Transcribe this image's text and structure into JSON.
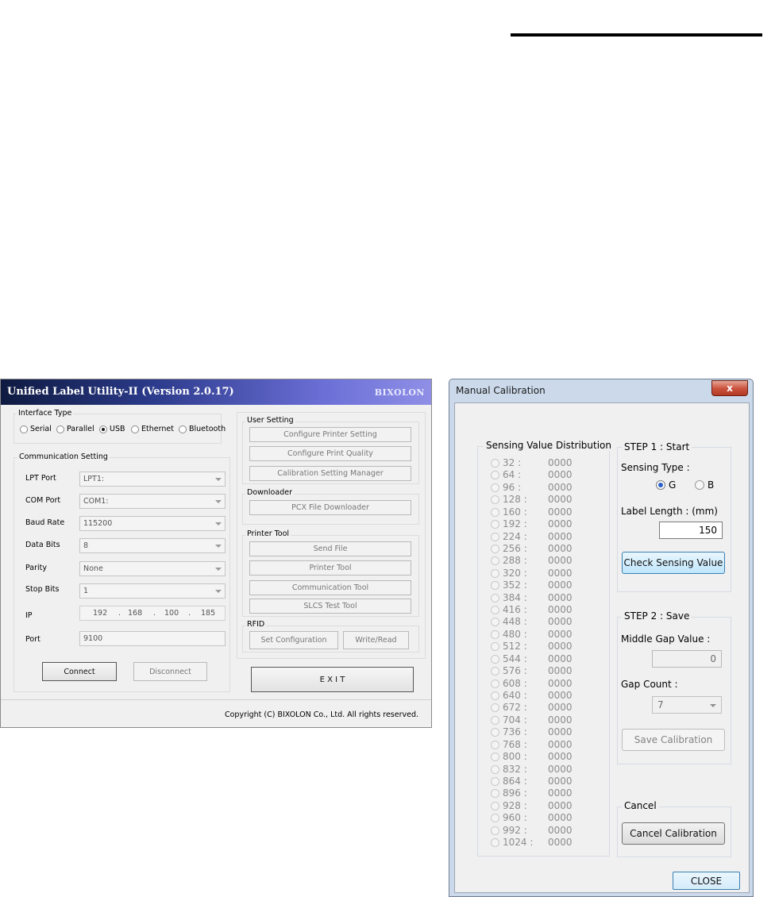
{
  "ulu": {
    "title": "Unified Label Utility-II (Version 2.0.17)",
    "brand": "BIXOLON",
    "interface_type": {
      "label": "Interface Type",
      "options": [
        "Serial",
        "Parallel",
        "USB",
        "Ethernet",
        "Bluetooth"
      ],
      "selected": "USB"
    },
    "comm": {
      "label": "Communication Setting",
      "lpt_label": "LPT Port",
      "lpt_value": "LPT1:",
      "com_label": "COM Port",
      "com_value": "COM1:",
      "baud_label": "Baud Rate",
      "baud_value": "115200",
      "databits_label": "Data Bits",
      "databits_value": "8",
      "parity_label": "Parity",
      "parity_value": "None",
      "stopbits_label": "Stop Bits",
      "stopbits_value": "1",
      "ip_label": "IP",
      "ip": [
        "192",
        "168",
        "100",
        "185"
      ],
      "ip_sep": ".",
      "port_label": "Port",
      "port_value": "9100",
      "connect": "Connect",
      "disconnect": "Disconnect"
    },
    "user_setting": {
      "label": "User Setting",
      "configure_printer": "Configure Printer Setting",
      "configure_quality": "Configure Print Quality",
      "calibration_manager": "Calibration Setting Manager"
    },
    "downloader": {
      "label": "Downloader",
      "pcx": "PCX File Downloader"
    },
    "printer_tool": {
      "label": "Printer Tool",
      "send_file": "Send File",
      "printer_tool": "Printer Tool",
      "communication_tool": "Communication Tool",
      "slcs_tool": "SLCS Test Tool"
    },
    "rfid": {
      "label": "RFID",
      "set_config": "Set Configuration",
      "write_read": "Write/Read"
    },
    "exit": "E X I T",
    "copyright": "Copyright (C) BIXOLON Co., Ltd. All rights reserved."
  },
  "calib": {
    "title": "Manual Calibration",
    "close_x": "x",
    "dist_label": "Sensing Value Distribution",
    "distribution": [
      {
        "k": "32 :",
        "v": "0000"
      },
      {
        "k": "64 :",
        "v": "0000"
      },
      {
        "k": "96 :",
        "v": "0000"
      },
      {
        "k": "128 :",
        "v": "0000"
      },
      {
        "k": "160 :",
        "v": "0000"
      },
      {
        "k": "192 :",
        "v": "0000"
      },
      {
        "k": "224 :",
        "v": "0000"
      },
      {
        "k": "256 :",
        "v": "0000"
      },
      {
        "k": "288 :",
        "v": "0000"
      },
      {
        "k": "320 :",
        "v": "0000"
      },
      {
        "k": "352 :",
        "v": "0000"
      },
      {
        "k": "384 :",
        "v": "0000"
      },
      {
        "k": "416 :",
        "v": "0000"
      },
      {
        "k": "448 :",
        "v": "0000"
      },
      {
        "k": "480 :",
        "v": "0000"
      },
      {
        "k": "512 :",
        "v": "0000"
      },
      {
        "k": "544 :",
        "v": "0000"
      },
      {
        "k": "576 :",
        "v": "0000"
      },
      {
        "k": "608 :",
        "v": "0000"
      },
      {
        "k": "640 :",
        "v": "0000"
      },
      {
        "k": "672 :",
        "v": "0000"
      },
      {
        "k": "704 :",
        "v": "0000"
      },
      {
        "k": "736 :",
        "v": "0000"
      },
      {
        "k": "768 :",
        "v": "0000"
      },
      {
        "k": "800 :",
        "v": "0000"
      },
      {
        "k": "832 :",
        "v": "0000"
      },
      {
        "k": "864 :",
        "v": "0000"
      },
      {
        "k": "896 :",
        "v": "0000"
      },
      {
        "k": "928 :",
        "v": "0000"
      },
      {
        "k": "960 :",
        "v": "0000"
      },
      {
        "k": "992 :",
        "v": "0000"
      },
      {
        "k": "1024 :",
        "v": "0000"
      }
    ],
    "step1": {
      "label": "STEP 1 : Start",
      "sensing_type_label": "Sensing Type :",
      "opt_g": "G",
      "opt_b": "B",
      "selected": "G",
      "label_length_label": "Label Length : (mm)",
      "label_length": "150",
      "check_button": "Check Sensing Value"
    },
    "step2": {
      "label": "STEP 2 : Save",
      "middle_gap_label": "Middle Gap Value :",
      "middle_gap": "0",
      "gap_count_label": "Gap Count :",
      "gap_count": "7",
      "save_button": "Save Calibration"
    },
    "cancel": {
      "label": "Cancel",
      "button": "Cancel Calibration"
    },
    "close_button": "CLOSE"
  }
}
